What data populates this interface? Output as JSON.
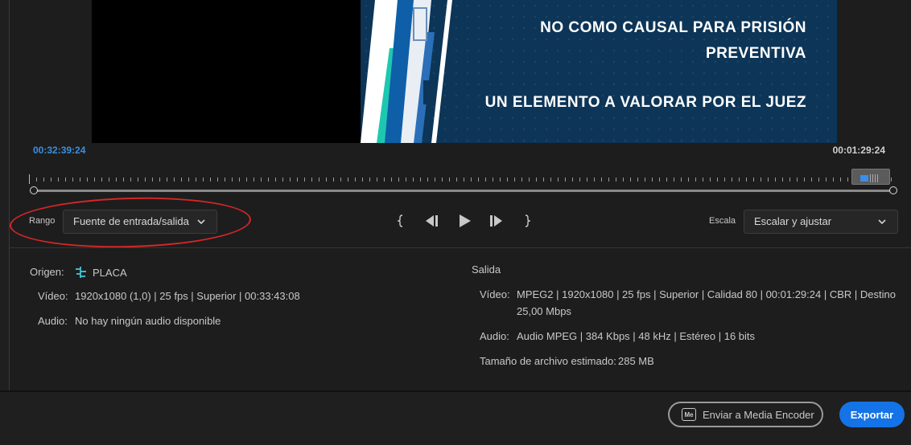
{
  "preview": {
    "overlay_line1": "NO COMO CAUSAL PARA PRISIÓN",
    "overlay_line2": "PREVENTIVA",
    "overlay_line3": "UN ELEMENTO A VALORAR POR EL JUEZ",
    "frame_color": "#0c3557"
  },
  "timeline": {
    "timecode_in": "00:32:39:24",
    "timecode_duration": "00:01:29:24"
  },
  "controls": {
    "range_label": "Rango",
    "range_value": "Fuente de entrada/salida",
    "scale_label": "Escala",
    "scale_value": "Escalar y ajustar",
    "icons": [
      "mark-in-icon",
      "step-back-icon",
      "play-icon",
      "step-forward-icon",
      "mark-out-icon"
    ]
  },
  "source": {
    "title": "Origen:",
    "name": "PLACA",
    "video_label": "Vídeo:",
    "video_value": "1920x1080 (1,0) | 25 fps | Superior | 00:33:43:08",
    "audio_label": "Audio:",
    "audio_value": "No hay ningún audio disponible"
  },
  "output": {
    "title": "Salida",
    "video_label": "Vídeo:",
    "video_value_line1": "MPEG2 | 1920x1080 | 25 fps | Superior | Calidad 80 | 00:01:29:24 | CBR | Destino",
    "video_value_line2": "25,00 Mbps",
    "audio_label": "Audio:",
    "audio_value": "Audio MPEG | 384 Kbps | 48 kHz | Estéreo | 16 bits",
    "size_label": "Tamaño de archivo estimado:",
    "size_value": "285 MB"
  },
  "footer": {
    "media_encoder_badge": "Me",
    "media_encoder_label": "Enviar a Media Encoder",
    "export_label": "Exportar",
    "accent_color": "#1473e6"
  }
}
